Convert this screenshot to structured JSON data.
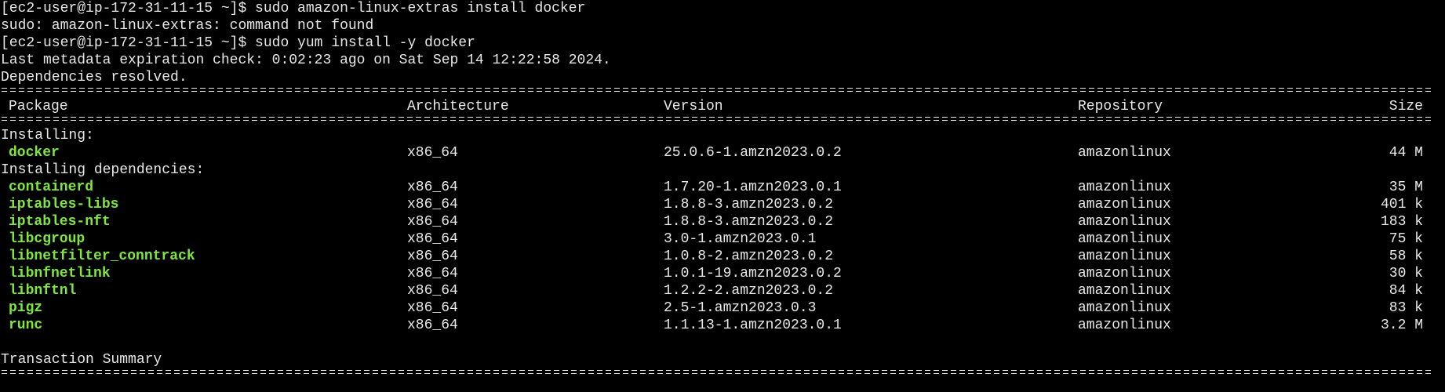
{
  "terminal": {
    "lines": {
      "cmd1": "[ec2-user@ip-172-31-11-15 ~]$ sudo amazon-linux-extras install docker",
      "err1": "sudo: amazon-linux-extras: command not found",
      "cmd2": "[ec2-user@ip-172-31-11-15 ~]$ sudo yum install -y docker",
      "meta": "Last metadata expiration check: 0:02:23 ago on Sat Sep 14 12:22:58 2024.",
      "deps": "Dependencies resolved."
    },
    "headers": {
      "package": "Package",
      "architecture": "Architecture",
      "version": "Version",
      "repository": "Repository",
      "size": "Size"
    },
    "installing_label": "Installing:",
    "installing": [
      {
        "package": "docker",
        "arch": "x86_64",
        "version": "25.0.6-1.amzn2023.0.2",
        "repo": "amazonlinux",
        "size": "44 M"
      }
    ],
    "deps_label": "Installing dependencies:",
    "dependencies": [
      {
        "package": "containerd",
        "arch": "x86_64",
        "version": "1.7.20-1.amzn2023.0.1",
        "repo": "amazonlinux",
        "size": "35 M"
      },
      {
        "package": "iptables-libs",
        "arch": "x86_64",
        "version": "1.8.8-3.amzn2023.0.2",
        "repo": "amazonlinux",
        "size": "401 k"
      },
      {
        "package": "iptables-nft",
        "arch": "x86_64",
        "version": "1.8.8-3.amzn2023.0.2",
        "repo": "amazonlinux",
        "size": "183 k"
      },
      {
        "package": "libcgroup",
        "arch": "x86_64",
        "version": "3.0-1.amzn2023.0.1",
        "repo": "amazonlinux",
        "size": "75 k"
      },
      {
        "package": "libnetfilter_conntrack",
        "arch": "x86_64",
        "version": "1.0.8-2.amzn2023.0.2",
        "repo": "amazonlinux",
        "size": "58 k"
      },
      {
        "package": "libnfnetlink",
        "arch": "x86_64",
        "version": "1.0.1-19.amzn2023.0.2",
        "repo": "amazonlinux",
        "size": "30 k"
      },
      {
        "package": "libnftnl",
        "arch": "x86_64",
        "version": "1.2.2-2.amzn2023.0.2",
        "repo": "amazonlinux",
        "size": "84 k"
      },
      {
        "package": "pigz",
        "arch": "x86_64",
        "version": "2.5-1.amzn2023.0.3",
        "repo": "amazonlinux",
        "size": "83 k"
      },
      {
        "package": "runc",
        "arch": "x86_64",
        "version": "1.1.13-1.amzn2023.0.1",
        "repo": "amazonlinux",
        "size": "3.2 M"
      }
    ],
    "summary_label": "Transaction Summary"
  },
  "colors": {
    "background": "#000000",
    "text": "#e8e8e8",
    "package_name": "#7ee83a"
  }
}
